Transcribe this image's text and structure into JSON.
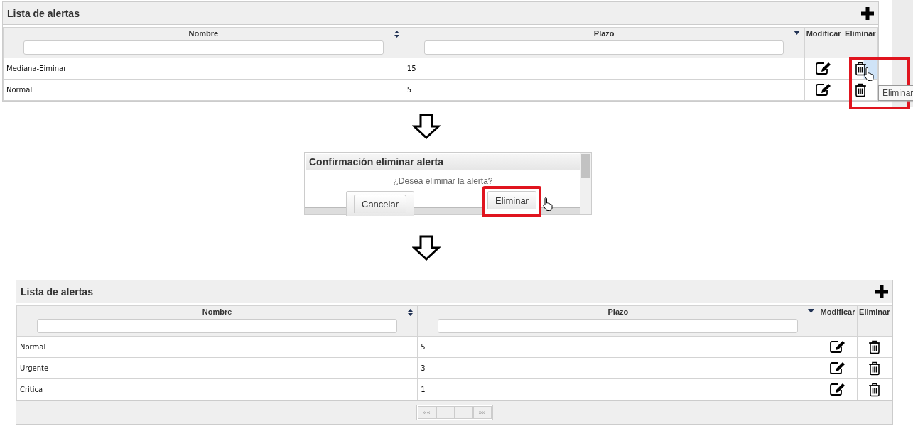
{
  "before_table": {
    "title": "Lista de alertas",
    "columns": [
      {
        "label": "Nombre",
        "sortable": true,
        "sorted_descending": false
      },
      {
        "label": "Plazo",
        "sortable": true,
        "sorted_descending": true
      },
      {
        "label": "Modificar",
        "sortable": false
      },
      {
        "label": "Eliminar",
        "sortable": false
      }
    ],
    "rows": [
      {
        "name": "Mediana-Eiminar",
        "plazo": "15",
        "hovered": true
      },
      {
        "name": "Normal",
        "plazo": "5",
        "hovered": false
      }
    ],
    "delete_highlighted": true,
    "tooltip": "Eliminar"
  },
  "confirm_dialog": {
    "title": "Confirmación eliminar alerta",
    "message": "¿Desea eliminar la alerta?",
    "buttons": [
      {
        "label": "Cancelar",
        "highlighted": false
      },
      {
        "label": "Eliminar",
        "highlighted": true
      }
    ]
  },
  "after_table": {
    "title": "Lista de alertas",
    "columns": [
      {
        "label": "Nombre",
        "sortable": true,
        "sorted_descending": false
      },
      {
        "label": "Plazo",
        "sortable": true,
        "sorted_descending": true
      },
      {
        "label": "Modificar",
        "sortable": false
      },
      {
        "label": "Eliminar",
        "sortable": false
      }
    ],
    "rows": [
      {
        "name": "Normal",
        "plazo": "5",
        "hovered": false
      },
      {
        "name": "Urgente",
        "plazo": "3",
        "hovered": false
      },
      {
        "name": "Critica",
        "plazo": "1",
        "hovered": false
      }
    ],
    "pagination": {
      "first": "««",
      "last": "»»"
    }
  }
}
